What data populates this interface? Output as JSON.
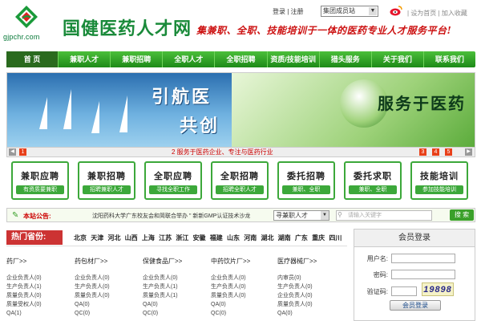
{
  "header": {
    "domain": "gjpchr.com",
    "brand": "国健医药人才网",
    "slogan": "集兼职、全职、技能培训于一体的医药专业人才服务平台!",
    "login_link": "登录",
    "separator": "|",
    "register_link": "注册",
    "site_select": "集团成员站",
    "set_home": "设为首页",
    "favorite": "加入收藏",
    "icons": [
      "logo-icon",
      "weibo-icon"
    ]
  },
  "nav": {
    "items": [
      "首 页",
      "兼职人才",
      "兼职招聘",
      "全职人才",
      "全职招聘",
      "资质/技能培训",
      "猎头服务",
      "关于我们",
      "联系我们"
    ],
    "active_index": 0
  },
  "banner": {
    "title_left_1": "引航医",
    "title_left_2": "共创",
    "title_right": "服务于医药",
    "caption": "2 服务于医药企业、专注与医药行业",
    "left_page": "1",
    "pages": [
      "3",
      "4",
      "5"
    ]
  },
  "quick_buttons": [
    {
      "title": "兼职应聘",
      "sub": "有资质要兼职"
    },
    {
      "title": "兼职招聘",
      "sub": "招聘兼职人才"
    },
    {
      "title": "全职应聘",
      "sub": "寻找全职工作"
    },
    {
      "title": "全职招聘",
      "sub": "招聘全职人才"
    },
    {
      "title": "委托招聘",
      "sub": "兼职、全职"
    },
    {
      "title": "委托求职",
      "sub": "兼职、全职"
    },
    {
      "title": "技能培训",
      "sub": "参加技能培训"
    }
  ],
  "notice": {
    "label": "本站公告:",
    "text": "沈阳药科大学广东校友会和简联合举办 \" 新新GMP认证技术沙龙",
    "job_select": "寻兼职人才",
    "keyword_placeholder": "请输入关键字",
    "search_button": "搜 索"
  },
  "provinces": {
    "label": "热门省份:",
    "list": "北京 天津 河北 山西 上海 江苏 浙江 安徽 福建 山东 河南 湖北 湖南 广东 重庆 四川"
  },
  "categories": [
    {
      "heading": "药厂>>",
      "rows": [
        "企业负责人(0)",
        "生产负责人(1)",
        "质量负责人(0)",
        "质量受权人(0)",
        "QA(1)"
      ]
    },
    {
      "heading": "药包材厂>>",
      "rows": [
        "企业负责人(0)",
        "生产负责人(0)",
        "质量负责人(0)",
        "QA(0)",
        "QC(0)"
      ]
    },
    {
      "heading": "保健食品厂>>",
      "rows": [
        "企业负责人(0)",
        "生产负责人(1)",
        "质量负责人(1)",
        "QA(0)",
        "QC(0)"
      ]
    },
    {
      "heading": "中药饮片厂>>",
      "rows": [
        "企业负责人(0)",
        "生产负责人(0)",
        "质量负责人(0)",
        "QA(0)",
        "QC(0)"
      ]
    },
    {
      "heading": "医疗器械厂>>",
      "rows": [
        "内审员(0)",
        "生产负责人(0)",
        "企业负责人(0)",
        "质量负责人(0)",
        "QA(0)"
      ]
    }
  ],
  "login": {
    "title": "会员登录",
    "username_label": "用户名:",
    "password_label": "密码:",
    "captcha_label": "验证码:",
    "captcha_value": "19898",
    "button": "会员登录"
  }
}
